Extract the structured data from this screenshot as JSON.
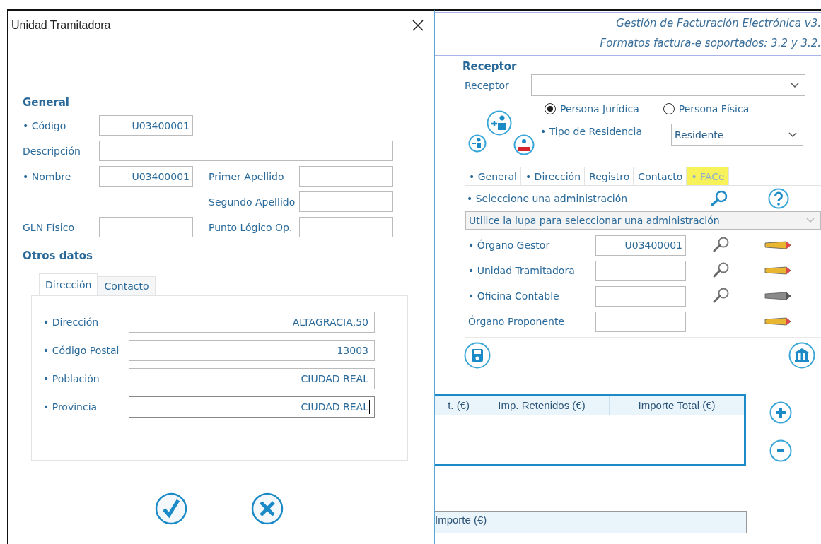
{
  "dialog": {
    "title": "Unidad Tramitadora",
    "general_heading": "General",
    "general": [
      {
        "label": "• Código",
        "value": "U03400001"
      },
      {
        "label": "Descripción"
      },
      {
        "label": "• Nombre",
        "value": "U03400001"
      },
      {
        "label": "Primer Apellido"
      },
      {
        "label": "Segundo Apellido"
      },
      {
        "label": "GLN Físico"
      },
      {
        "label": "Punto Lógico Op."
      }
    ],
    "other_heading": "Otros datos",
    "tabs": [
      {
        "label": "Dirección",
        "selected": true
      },
      {
        "label": "Contacto",
        "selected": false
      }
    ],
    "address": [
      {
        "label": "• Dirección",
        "value": "ALTAGRACIA,50",
        "focused": false
      },
      {
        "label": "• Código Postal",
        "value": "13003",
        "focused": false
      },
      {
        "label": "• Población",
        "value": "CIUDAD REAL",
        "focused": false
      },
      {
        "label": "• Provincia",
        "value": "CIUDAD REAL",
        "focused": true
      }
    ]
  },
  "main": {
    "title": "Gestión de Facturación Electrónica v3.",
    "subtitle": "Formatos factura-e soportados: 3.2 y 3.2.",
    "receptor_heading": "Receptor",
    "receptor_label": "Receptor",
    "person_types": [
      {
        "label": "Persona Jurídica",
        "selected": true
      },
      {
        "label": "Persona Física",
        "selected": false
      }
    ],
    "residence_label": "• Tipo de Residencia",
    "residence_value": "Residente",
    "tabs": [
      {
        "label": "• General",
        "selected": false,
        "highlighted": false
      },
      {
        "label": "• Dirección",
        "selected": false,
        "highlighted": false
      },
      {
        "label": "Registro",
        "selected": false,
        "highlighted": false
      },
      {
        "label": "Contacto",
        "selected": false,
        "highlighted": false
      },
      {
        "label": "• FACe",
        "selected": true,
        "highlighted": true
      }
    ],
    "admin_label": "• Seleccione una administración",
    "admin_select": "Utilice la lupa para seleccionar una administración",
    "organs": [
      {
        "label": "• Órgano Gestor",
        "value": "U03400001",
        "search": true,
        "pencil_enabled": true
      },
      {
        "label": "• Unidad Tramitadora",
        "search": true,
        "pencil_enabled": true
      },
      {
        "label": "• Oficina Contable",
        "search": true,
        "pencil_enabled": false
      },
      {
        "label": "Órgano Proponente",
        "search": false,
        "pencil_enabled": true
      }
    ],
    "table": {
      "columns": [
        "t. (€)",
        "Imp. Retenidos (€)",
        "Importe Total (€)"
      ]
    },
    "table2": {
      "columns": [
        "Importe (€)"
      ]
    }
  }
}
